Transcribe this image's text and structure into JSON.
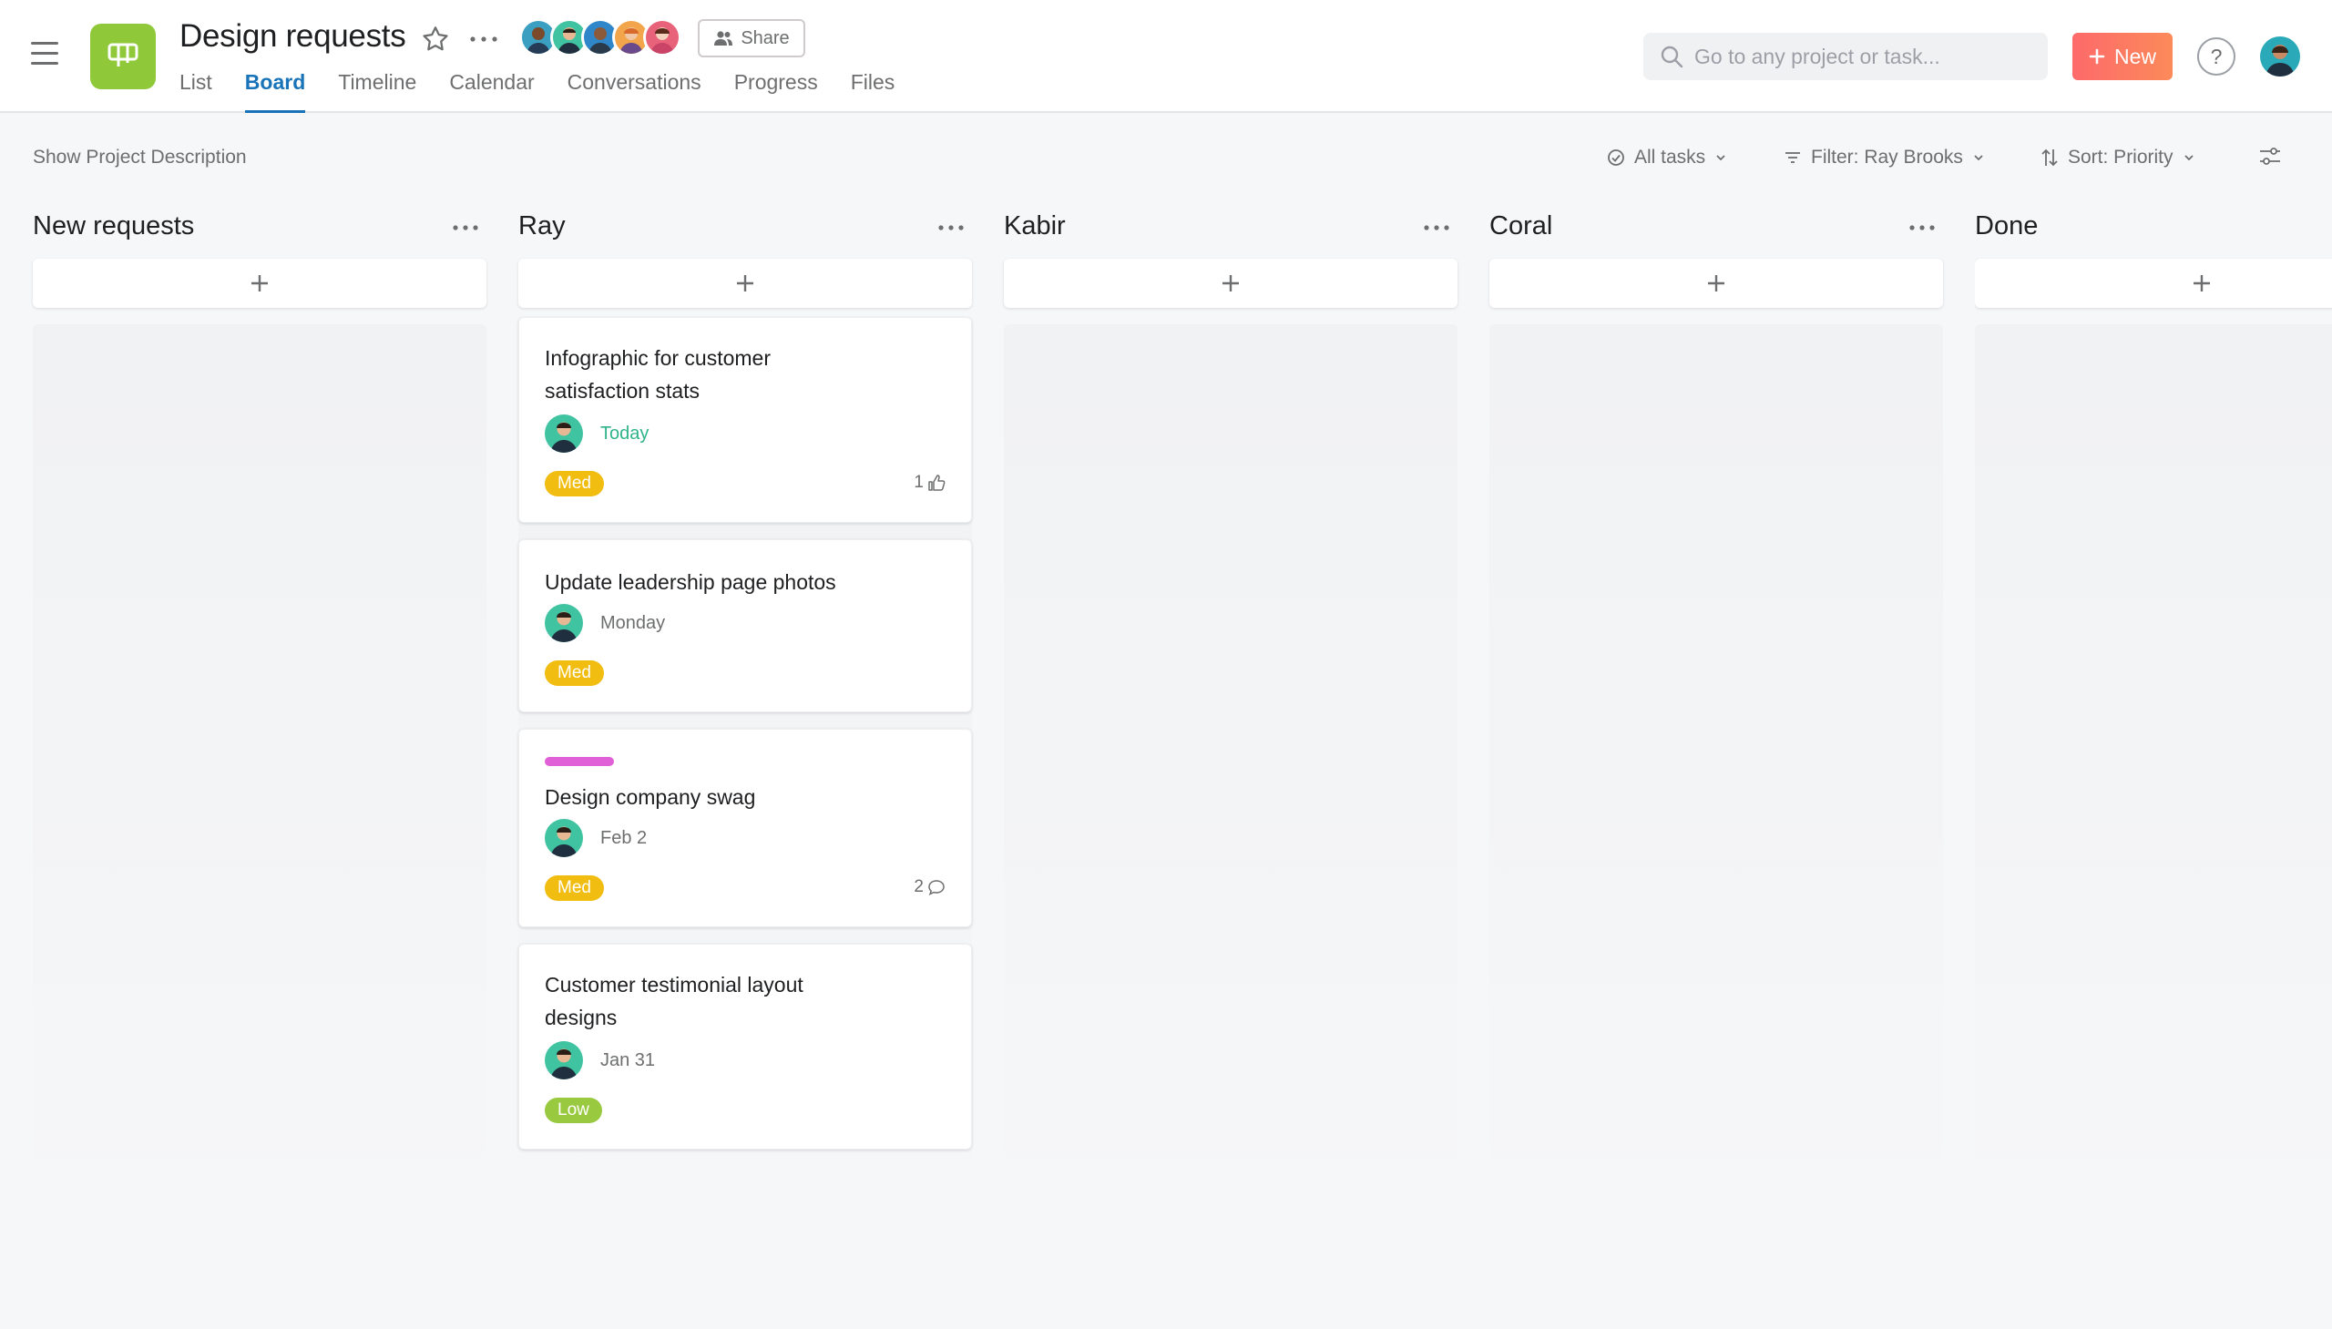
{
  "header": {
    "project_title": "Design requests",
    "project_color": "#8fc93a",
    "share_label": "Share",
    "tabs": [
      {
        "label": "List",
        "active": false
      },
      {
        "label": "Board",
        "active": true
      },
      {
        "label": "Timeline",
        "active": false
      },
      {
        "label": "Calendar",
        "active": false
      },
      {
        "label": "Conversations",
        "active": false
      },
      {
        "label": "Progress",
        "active": false
      },
      {
        "label": "Files",
        "active": false
      }
    ],
    "search_placeholder": "Go to any project or task...",
    "new_label": "New",
    "help_label": "?",
    "members_count": 5
  },
  "toolbar": {
    "show_description": "Show Project Description",
    "all_tasks": "All tasks",
    "filter": "Filter: Ray Brooks",
    "sort": "Sort: Priority"
  },
  "board": {
    "columns": [
      {
        "title": "New requests"
      },
      {
        "title": "Ray"
      },
      {
        "title": "Kabir"
      },
      {
        "title": "Coral"
      },
      {
        "title": "Done"
      }
    ],
    "ray_cards": [
      {
        "title": "Infographic for customer satisfaction stats",
        "date": "Today",
        "priority": "Med",
        "meta": "1"
      },
      {
        "title": "Update leadership page photos",
        "date": "Monday",
        "priority": "Med"
      },
      {
        "title": "Design company swag",
        "date": "Feb 2",
        "priority": "Med",
        "meta": "2",
        "tag_color": "#e060d7"
      },
      {
        "title": "Customer testimonial layout designs",
        "date": "Jan 31",
        "priority": "Low"
      }
    ]
  },
  "colors": {
    "accent": "#1973b8",
    "new_button": "#fd6a6a",
    "priority_med": "#f1bd11",
    "priority_low": "#99c93e",
    "today": "#2fb38a"
  }
}
